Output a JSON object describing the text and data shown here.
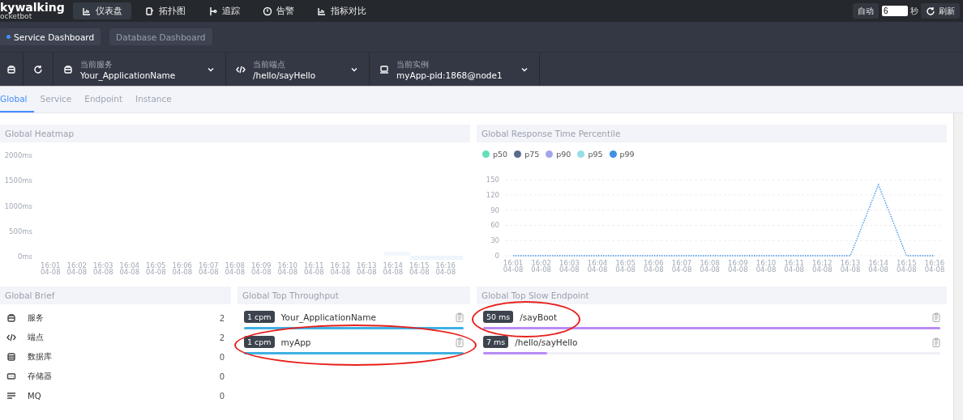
{
  "logo": {
    "title": "kywalking",
    "subtitle": "ocketbot"
  },
  "nav": [
    {
      "label": "仪表盘",
      "selected": true
    },
    {
      "label": "拓扑图",
      "selected": false
    },
    {
      "label": "追踪",
      "selected": false
    },
    {
      "label": "告警",
      "selected": false
    },
    {
      "label": "指标对比",
      "selected": false
    }
  ],
  "auto_refresh": {
    "auto_label": "自动",
    "interval": "6",
    "unit": "秒",
    "refresh_label": "刷新"
  },
  "dashboards": [
    {
      "label": "Service Dashboard",
      "selected": true
    },
    {
      "label": "Database Dashboard",
      "selected": false
    }
  ],
  "selectors": [
    {
      "caption": "当前服务",
      "value": "Your_ApplicationName"
    },
    {
      "caption": "当前端点",
      "value": "/hello/sayHello"
    },
    {
      "caption": "当前实例",
      "value": "myApp-pid:1868@node1"
    }
  ],
  "tabs": [
    {
      "label": "Global",
      "selected": true
    },
    {
      "label": "Service",
      "selected": false
    },
    {
      "label": "Endpoint",
      "selected": false
    },
    {
      "label": "Instance",
      "selected": false
    }
  ],
  "heatmap": {
    "title": "Global Heatmap",
    "y_ticks": [
      "2000ms",
      "1500ms",
      "1000ms",
      "500ms",
      "0ms"
    ],
    "x_labels": [
      "16:01 04-08",
      "16:02 04-08",
      "16:03 04-08",
      "16:04 04-08",
      "16:05 04-08",
      "16:06 04-08",
      "16:07 04-08",
      "16:08 04-08",
      "16:09 04-08",
      "16:10 04-08",
      "16:11 04-08",
      "16:12 04-08",
      "16:13 04-08",
      "16:14 04-08",
      "16:15 04-08",
      "16:16 04-08"
    ]
  },
  "percentile": {
    "title": "Global Response Time Percentile",
    "chart_data": {
      "type": "line",
      "grid": true,
      "categories": [
        "16:01 04-08",
        "16:02 04-08",
        "16:03 04-08",
        "16:04 04-08",
        "16:05 04-08",
        "16:06 04-08",
        "16:07 04-08",
        "16:08 04-08",
        "16:09 04-08",
        "16:10 04-08",
        "16:11 04-08",
        "16:12 04-08",
        "16:13 04-08",
        "16:14 04-08",
        "16:15 04-08",
        "16:16 04-08"
      ],
      "ylim": [
        0,
        150
      ],
      "yticks": [
        0,
        30,
        60,
        90,
        120,
        150
      ],
      "series": [
        {
          "name": "p50",
          "color": "#5ee0b9",
          "values": [
            null,
            null,
            null,
            null,
            null,
            null,
            null,
            null,
            null,
            null,
            null,
            null,
            null,
            null,
            null,
            null
          ]
        },
        {
          "name": "p75",
          "color": "#5b6a8e",
          "values": [
            null,
            null,
            null,
            null,
            null,
            null,
            null,
            null,
            null,
            null,
            null,
            null,
            null,
            null,
            null,
            null
          ]
        },
        {
          "name": "p90",
          "color": "#a3a4ec",
          "values": [
            null,
            null,
            null,
            null,
            null,
            null,
            null,
            null,
            null,
            null,
            null,
            null,
            null,
            null,
            null,
            null
          ]
        },
        {
          "name": "p95",
          "color": "#96dfe8",
          "values": [
            null,
            null,
            null,
            null,
            null,
            null,
            null,
            null,
            null,
            null,
            null,
            null,
            null,
            null,
            null,
            null
          ]
        },
        {
          "name": "p99",
          "color": "#3c92e4",
          "line_style": "dotted",
          "values": [
            0,
            0,
            0,
            0,
            0,
            0,
            0,
            0,
            0,
            0,
            0,
            0,
            0,
            140,
            0,
            0
          ]
        }
      ]
    }
  },
  "brief": {
    "title": "Global Brief",
    "items": [
      {
        "label": "服务",
        "value": "2"
      },
      {
        "label": "端点",
        "value": "2"
      },
      {
        "label": "数据库",
        "value": "0"
      },
      {
        "label": "存储器",
        "value": "0"
      },
      {
        "label": "MQ",
        "value": "0"
      }
    ]
  },
  "throughput": {
    "title": "Global Top Throughput",
    "items": [
      {
        "badge": "1 cpm",
        "name": "Your_ApplicationName",
        "level": 1,
        "circled": false
      },
      {
        "badge": "1 cpm",
        "name": "myApp",
        "level": 1,
        "circled": true
      }
    ]
  },
  "slow": {
    "title": "Global Top Slow Endpoint",
    "items": [
      {
        "badge": "50 ms",
        "name": "/sayBoot",
        "level": 1,
        "circled": true
      },
      {
        "badge": "7 ms",
        "name": "/hello/sayHello",
        "level": 0.14,
        "circled": false
      }
    ]
  }
}
